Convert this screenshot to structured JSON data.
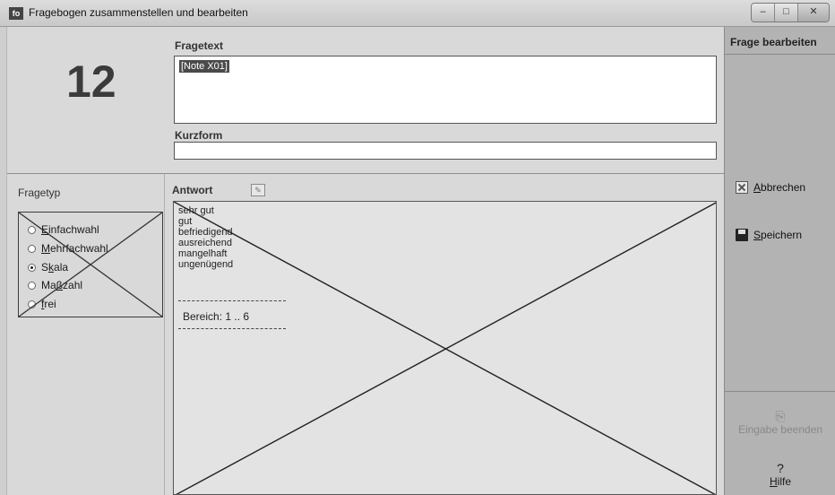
{
  "window": {
    "title": "Fragebogen zusammenstellen und bearbeiten",
    "controls": [
      "–",
      "□",
      "✕"
    ]
  },
  "question": {
    "number": "12",
    "fragetext_label": "Fragetext",
    "fragetext_value": "[Note X01]",
    "kurzform_label": "Kurzform",
    "kurzform_value": ""
  },
  "fragetyp": {
    "label": "Fragetyp",
    "options": [
      {
        "pre": "",
        "key": "E",
        "rest": "infachwahl",
        "checked": false
      },
      {
        "pre": "",
        "key": "M",
        "rest": "ehrfachwahl",
        "checked": false
      },
      {
        "pre": "S",
        "key": "k",
        "rest": "ala",
        "checked": true
      },
      {
        "pre": "Ma",
        "key": "ß",
        "rest": "zahl",
        "checked": false
      },
      {
        "pre": "",
        "key": "f",
        "rest": "rei",
        "checked": false
      }
    ]
  },
  "antwort": {
    "label": "Antwort",
    "items": [
      "sehr gut",
      "gut",
      "befriedigend",
      "ausreichend",
      "mangelhaft",
      "ungenügend"
    ],
    "bereich": "Bereich:  1 .. 6"
  },
  "side": {
    "title": "Frage bearbeiten",
    "cancel": {
      "key": "A",
      "rest": "bbrechen"
    },
    "save": {
      "key": "S",
      "rest": "peichern"
    },
    "finish": "Eingabe beenden",
    "help": {
      "key": "H",
      "rest": "ilfe"
    }
  }
}
